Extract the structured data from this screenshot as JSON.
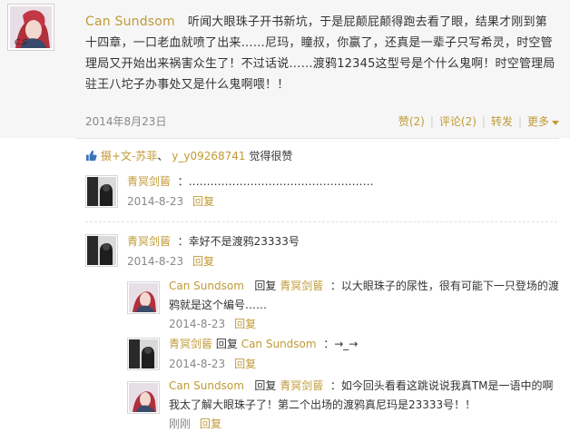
{
  "post": {
    "author": "Can Sundsom",
    "text": "听闻大眼珠子开书新坑，于是屁颠屁颠得跑去看了眼，结果才刚到第十四章，一口老血就喷了出来……尼玛，瞳叔，你赢了，还真是一辈子只写希灵，时空管理局又开始出来祸害众生了！不过话说……渡鸦12345这型号是个什么鬼啊！时空管理局驻王八坨子办事处又是什么鬼啊喂！！",
    "date": "2014年8月23日",
    "actions": {
      "like": "赞(2)",
      "comment": "评论(2)",
      "repost": "转发",
      "more": "更多"
    }
  },
  "likes": {
    "users": [
      "摄+文-苏菲",
      "y_y09268741"
    ],
    "separator": "、",
    "suffix": "觉得很赞"
  },
  "comments": [
    {
      "author": "青冥剑蒈",
      "text": "：……………………………………………",
      "date": "2014-8-23",
      "reply": "回复"
    },
    {
      "author": "青冥剑蒈",
      "text": "：幸好不是渡鸦23333号",
      "date": "2014-8-23",
      "reply": "回复",
      "replies": [
        {
          "author": "Can Sundsom",
          "reply_word": "回复",
          "target": "青冥剑蒈",
          "text_line1": "：以大眼珠子的尿性，很有可能下一只登场的渡",
          "text_line2": "鸦就是这个编号……",
          "date": "2014-8-23",
          "reply": "回复"
        },
        {
          "author": "青冥剑蒈",
          "reply_word": "回复",
          "target": "Can Sundsom",
          "text_line1": "：→_→",
          "date": "2014-8-23",
          "reply": "回复"
        },
        {
          "author": "Can Sundsom",
          "reply_word": "回复",
          "target": "青冥剑蒈",
          "text_line1": "：如今回头看看这跳说说我真TM是一语中的啊",
          "text_line2": "我太了解大眼珠子了！第二个出场的渡鸦真尼玛是23333号！！",
          "date": "刚刚",
          "reply": "回复"
        }
      ]
    }
  ],
  "colors": {
    "accent": "#c09a36",
    "muted": "#888888",
    "post_bg": "#f6f6f6"
  }
}
